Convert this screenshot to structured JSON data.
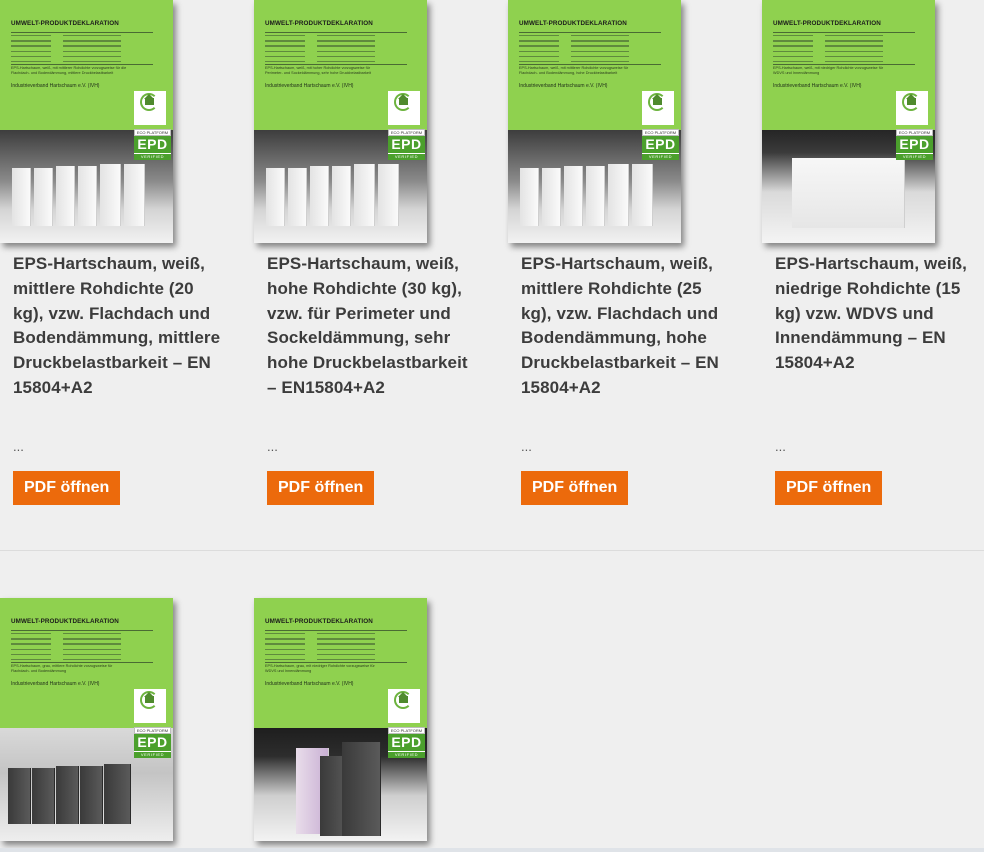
{
  "products": [
    {
      "description": "EPS-Hartschaum, weiß, mittlere Rohdichte (20 kg), vzw. Flachdach und Bodendämmung, mittlere Druckbelastbarkeit – EN 15804+A2",
      "ellipsis": "...",
      "button_label": "PDF öffnen",
      "cover": {
        "title": "UMWELT-PRODUKTDEKLARATION",
        "desc": "EPS-Hartschaum, weiß, mit mittlerer Rohdichte vorzugsweise für die Flachdach- und Bodendämmung, mittlere Druckbelastbarkeit",
        "publisher": "Industrieverband Hartschaum e.V. (IVH)",
        "photo": "white-slabs"
      }
    },
    {
      "description": "EPS-Hartschaum, weiß, hohe Rohdichte (30 kg), vzw. für Perimeter und Sockeldämmung, sehr hohe Druckbelastbarkeit – EN15804+A2",
      "ellipsis": "...",
      "button_label": "PDF öffnen",
      "cover": {
        "title": "UMWELT-PRODUKTDEKLARATION",
        "desc": "EPS-Hartschaum, weiß, mit hoher Rohdichte vorzugsweise für Perimeter- und Sockeldämmung, sehr hohe Druckbelastbarkeit",
        "publisher": "Industrieverband Hartschaum e.V. (IVH)",
        "photo": "white-slabs"
      }
    },
    {
      "description": "EPS-Hartschaum, weiß, mittlere Rohdichte (25 kg), vzw. Flachdach und Bodendämmung, hohe Druckbelastbarkeit – EN 15804+A2",
      "ellipsis": "...",
      "button_label": "PDF öffnen",
      "cover": {
        "title": "UMWELT-PRODUKTDEKLARATION",
        "desc": "EPS-Hartschaum, weiß, mit mittlerer Rohdichte vorzugsweise für Flachdach- und Bodendämmung, hohe Druckbelastbarkeit",
        "publisher": "Industrieverband Hartschaum e.V. (IVH)",
        "photo": "white-slabs"
      }
    },
    {
      "description": "EPS-Hartschaum, weiß, niedrige Rohdichte (15 kg) vzw. WDVS und Innendämmung – EN 15804+A2",
      "ellipsis": "...",
      "button_label": "PDF öffnen",
      "cover": {
        "title": "UMWELT-PRODUKTDEKLARATION",
        "desc": "EPS-Hartschaum, weiß, mit niedriger Rohdichte vorzugsweise für WDVS und Innendämmung",
        "publisher": "Industrieverband Hartschaum e.V. (IVH)",
        "photo": "white-block"
      }
    },
    {
      "cover": {
        "title": "UMWELT-PRODUKTDEKLARATION",
        "desc": "EPS-Hartschaum, grau, mittlere Rohdichte vorzugsweise für Flachdach- und Bodendämmung",
        "publisher": "Industrieverband Hartschaum e.V. (IVH)",
        "photo": "gray-slabs"
      }
    },
    {
      "cover": {
        "title": "UMWELT-PRODUKTDEKLARATION",
        "desc": "EPS-Hartschaum, grau, mit niedriger Rohdichte vorzugsweise für WDVS und Innendämmung",
        "publisher": "Industrieverband Hartschaum e.V. (IVH)",
        "photo": "gray-blocks"
      }
    }
  ],
  "cover_common": {
    "epo_top": "ECO PLATFORM",
    "epo_mid": "EPD",
    "epo_bot": "VERIFIED"
  }
}
